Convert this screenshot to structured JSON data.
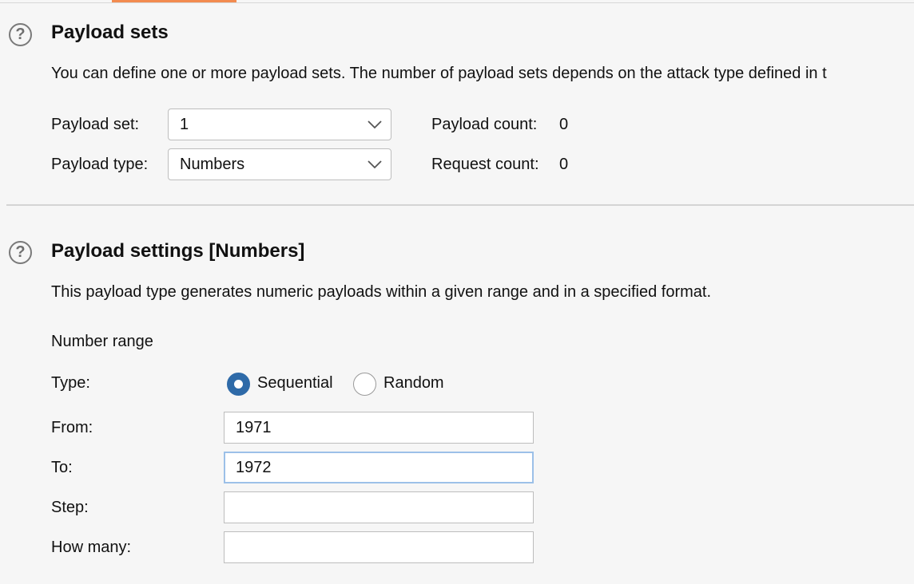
{
  "colors": {
    "accent_tab": "#f28b50",
    "radio_selected": "#2e6aa8",
    "focus_border": "#9cc0e8"
  },
  "payload_sets": {
    "help_icon": "?",
    "title": "Payload sets",
    "description": "You can define one or more payload sets. The number of payload sets depends on the attack type defined in t",
    "set_label": "Payload set:",
    "set_value": "1",
    "type_label": "Payload type:",
    "type_value": "Numbers",
    "payload_count_label": "Payload count:",
    "payload_count_value": "0",
    "request_count_label": "Request count:",
    "request_count_value": "0"
  },
  "payload_settings": {
    "help_icon": "?",
    "title": "Payload settings [Numbers]",
    "description": "This payload type generates numeric payloads within a given range and in a specified format.",
    "number_range_heading": "Number range",
    "type_label": "Type:",
    "sequential_label": "Sequential",
    "random_label": "Random",
    "selected_type": "Sequential",
    "from_label": "From:",
    "from_value": "1971",
    "to_label": "To:",
    "to_value": "1972",
    "step_label": "Step:",
    "step_value": "",
    "how_many_label": "How many:",
    "how_many_value": ""
  }
}
